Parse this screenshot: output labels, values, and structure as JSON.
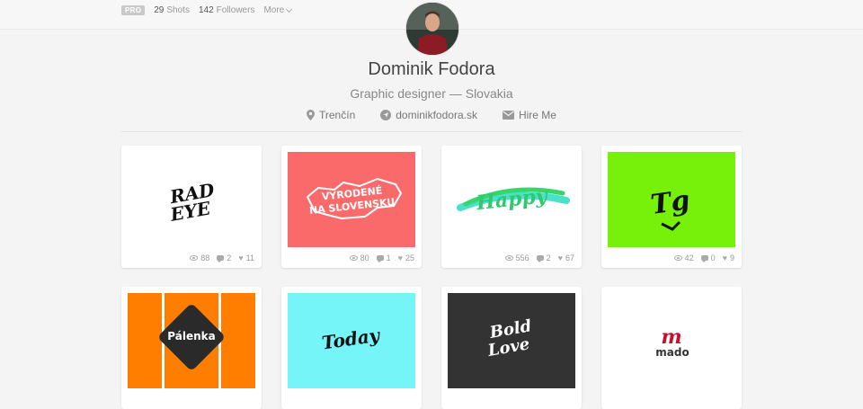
{
  "stats": {
    "pro": "PRO",
    "shots_count": "29",
    "shots_label": "Shots",
    "followers_count": "142",
    "followers_label": "Followers",
    "more_label": "More"
  },
  "profile": {
    "name": "Dominik Fodora",
    "bio": "Graphic designer — Slovakia",
    "location": "Trenčín",
    "website": "dominikfodora.sk",
    "hire": "Hire Me"
  },
  "shots": [
    {
      "views": "88",
      "comments": "2",
      "likes": "11",
      "art_text": "RAD EYE"
    },
    {
      "views": "80",
      "comments": "1",
      "likes": "25",
      "art_text": "VYRODENÉ NA SLOVENSKU"
    },
    {
      "views": "556",
      "comments": "2",
      "likes": "67",
      "art_text": "Happy"
    },
    {
      "views": "42",
      "comments": "0",
      "likes": "9",
      "art_text": "Tg"
    },
    {
      "art_text": "Pálenka"
    },
    {
      "art_text": "Today"
    },
    {
      "art_text": "Bold Love"
    },
    {
      "art_text": "mado"
    }
  ],
  "colors": {
    "thumb_red": "#fa6a6a",
    "thumb_green": "#77f10a",
    "thumb_orange": "#ff7e00",
    "thumb_cyan": "#75f5f7",
    "thumb_dark": "#333333",
    "brand_mado": "#c8102e"
  }
}
